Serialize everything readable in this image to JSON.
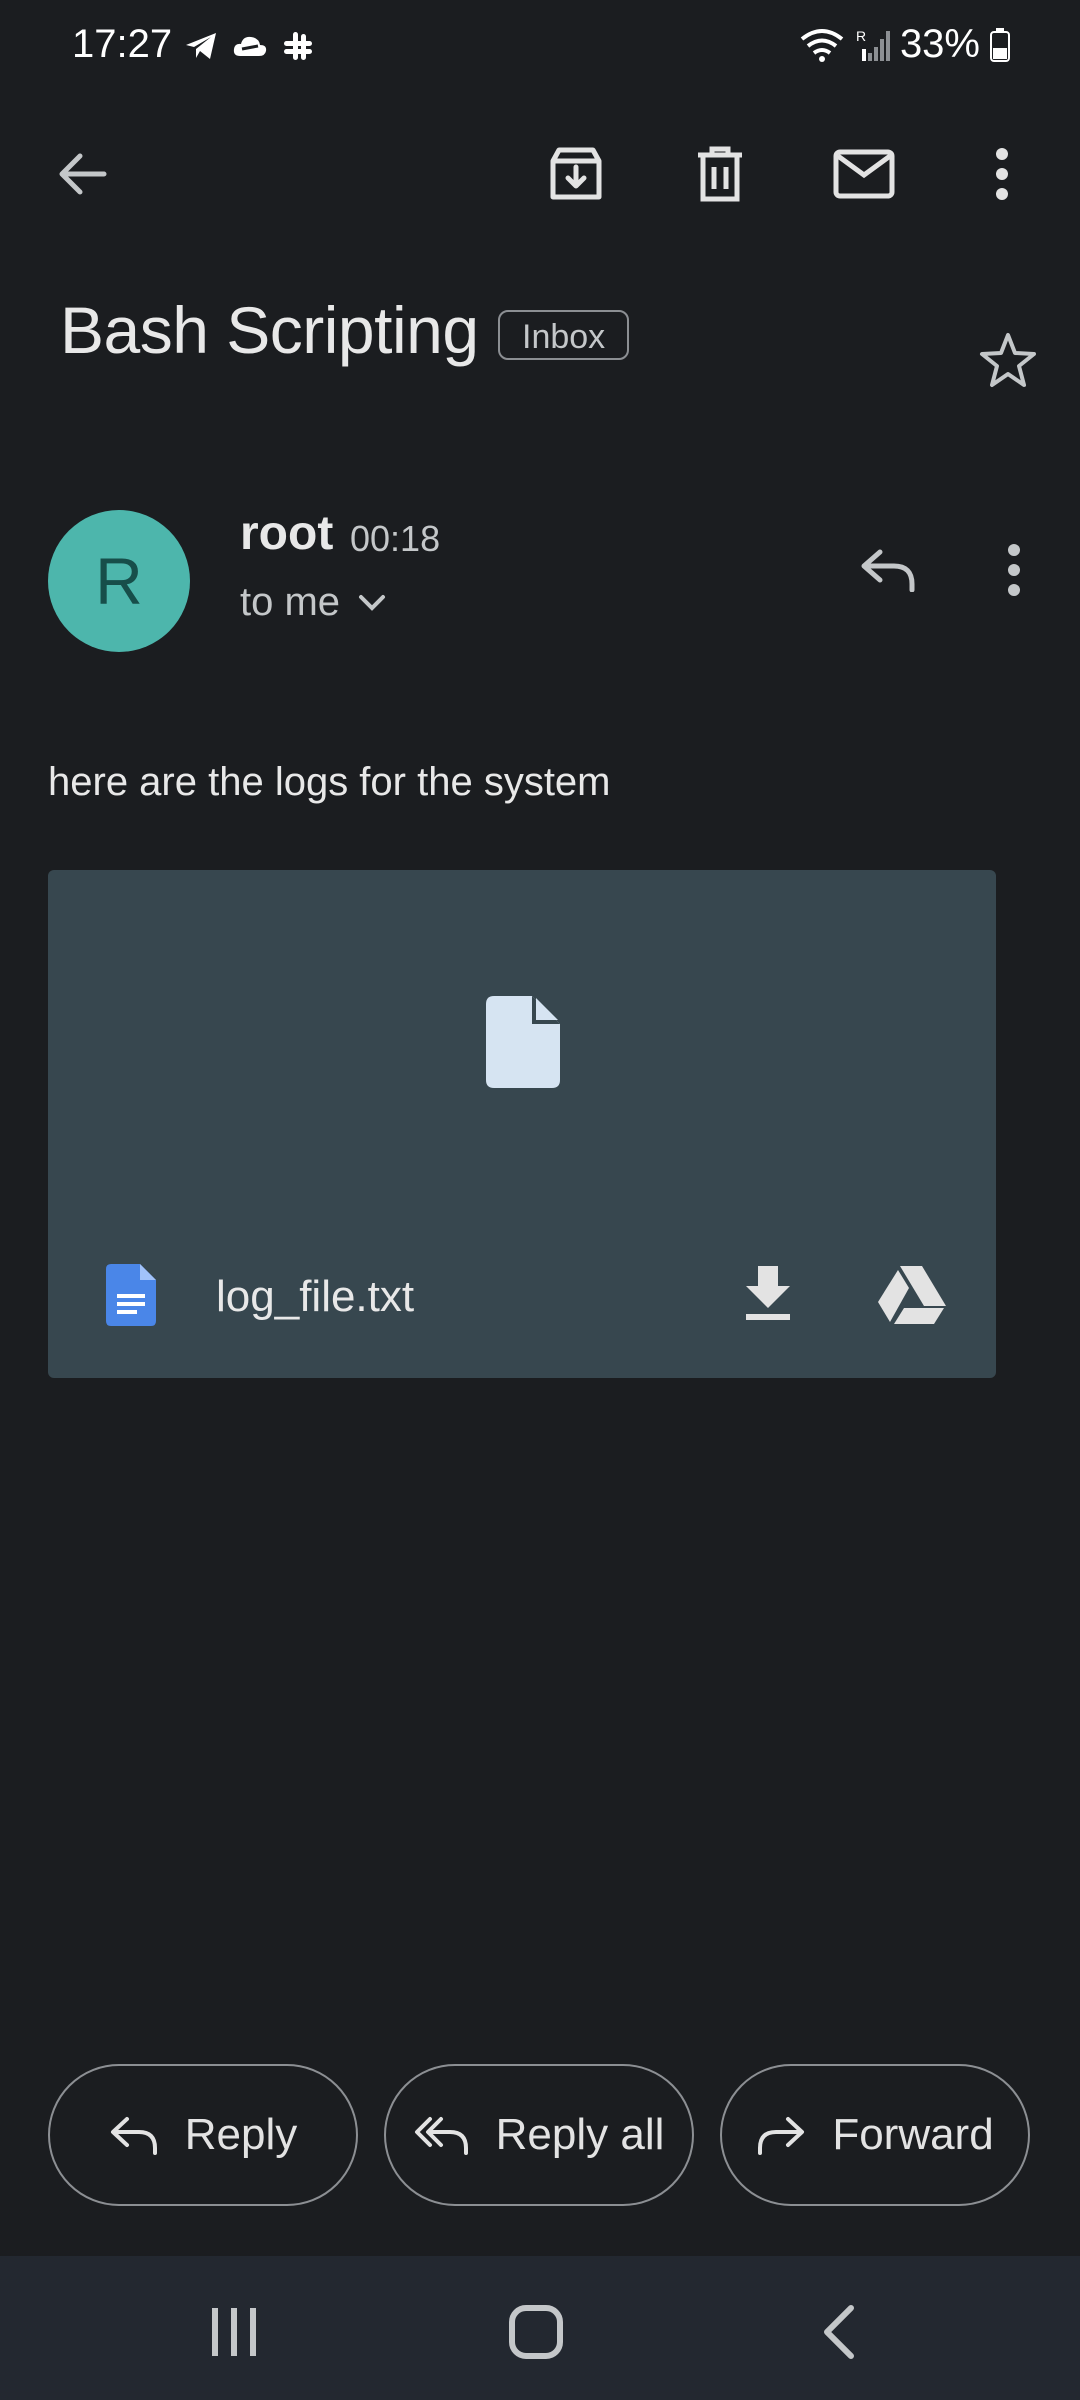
{
  "status_bar": {
    "time": "17:27",
    "battery_text": "33%",
    "app_icons": [
      "telegram-icon",
      "cloud-icon",
      "slack-icon"
    ],
    "signal_label": "R"
  },
  "toolbar": {
    "back_icon": "arrow-back-icon",
    "archive_icon": "archive-icon",
    "delete_icon": "trash-icon",
    "mark_unread_icon": "mail-icon",
    "more_icon": "more-vert-icon"
  },
  "email": {
    "subject": "Bash Scripting",
    "label": "Inbox",
    "sender_initial": "R",
    "sender_name": "root",
    "time": "00:18",
    "recipient": "to me",
    "body": "here are the logs for the system"
  },
  "attachment": {
    "filename": "log_file.txt",
    "preview_icon": "file-icon",
    "type_icon": "doc-icon",
    "download_icon": "download-icon",
    "drive_icon": "drive-icon"
  },
  "actions": {
    "reply": "Reply",
    "reply_all": "Reply all",
    "forward": "Forward"
  },
  "colors": {
    "background": "#1b1d20",
    "avatar": "#4db6ac",
    "attachment_card": "#37474f",
    "doc_icon": "#4a86e8",
    "navbar": "#232830"
  }
}
